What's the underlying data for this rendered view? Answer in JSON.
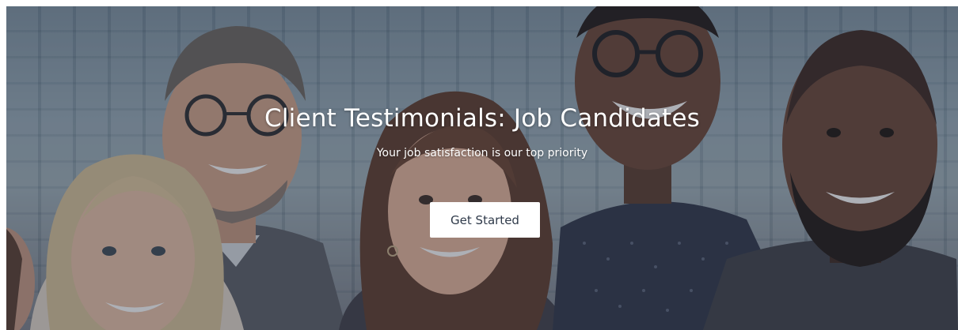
{
  "hero": {
    "title": "Client Testimonials: Job Candidates",
    "subtitle": "Your job satisfaction is our top priority",
    "cta_label": "Get Started",
    "overlay_color": "#28303e"
  }
}
